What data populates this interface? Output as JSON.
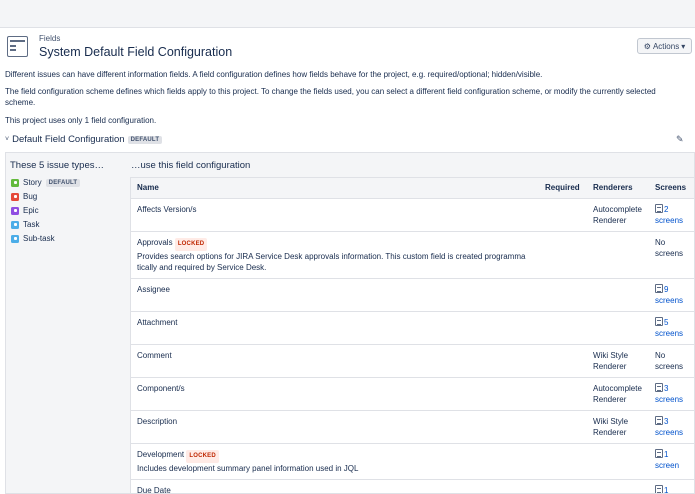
{
  "header": {
    "breadcrumb": "Fields",
    "title": "System Default Field Configuration",
    "actions_label": "Actions",
    "actions_icon": "gear-icon"
  },
  "descriptions": [
    "Different issues can have different information fields. A field configuration defines how fields behave for the project, e.g. required/optional; hidden/visible.",
    "The field configuration scheme defines which fields apply to this project. To change the fields used, you can select a different field configuration scheme, or modify the currently selected scheme.",
    "This project uses only 1 field configuration."
  ],
  "section": {
    "title": "Default Field Configuration",
    "badge": "DEFAULT"
  },
  "issue_types": {
    "heading": "These 5 issue types…",
    "items": [
      {
        "label": "Story",
        "badge": "DEFAULT",
        "color": "#63ba3c"
      },
      {
        "label": "Bug",
        "badge": "",
        "color": "#e5493a"
      },
      {
        "label": "Epic",
        "badge": "",
        "color": "#904ee2"
      },
      {
        "label": "Task",
        "badge": "",
        "color": "#4bade8"
      },
      {
        "label": "Sub-task",
        "badge": "",
        "color": "#4bade8"
      }
    ]
  },
  "config": {
    "heading": "…use this field configuration",
    "columns": {
      "name": "Name",
      "required": "Required",
      "renderers": "Renderers",
      "screens": "Screens"
    },
    "rows": [
      {
        "name": "Affects Version/s",
        "locked": "",
        "description": "",
        "renderer": "Autocomplete Renderer",
        "screens_count": "2",
        "screens_word": "screens",
        "screens_text": ""
      },
      {
        "name": "Approvals",
        "locked": "LOCKED",
        "description": "Provides search options for JIRA Service Desk approvals information. This custom field is created programma tically and required by Service Desk.",
        "renderer": "",
        "screens_count": "",
        "screens_word": "",
        "screens_text": "No screens"
      },
      {
        "name": "Assignee",
        "locked": "",
        "description": "",
        "renderer": "",
        "screens_count": "9",
        "screens_word": "screens",
        "screens_text": ""
      },
      {
        "name": "Attachment",
        "locked": "",
        "description": "",
        "renderer": "",
        "screens_count": "5",
        "screens_word": "screens",
        "screens_text": ""
      },
      {
        "name": "Comment",
        "locked": "",
        "description": "",
        "renderer": "Wiki Style Renderer",
        "screens_count": "",
        "screens_word": "",
        "screens_text": "No screens"
      },
      {
        "name": "Component/s",
        "locked": "",
        "description": "",
        "renderer": "Autocomplete Renderer",
        "screens_count": "3",
        "screens_word": "screens",
        "screens_text": ""
      },
      {
        "name": "Description",
        "locked": "",
        "description": "",
        "renderer": "Wiki Style Renderer",
        "screens_count": "3",
        "screens_word": "screens",
        "screens_text": ""
      },
      {
        "name": "Development",
        "locked": "LOCKED",
        "description": "Includes development summary panel information used in JQL",
        "renderer": "",
        "screens_count": "1",
        "screens_word": "screen",
        "screens_text": ""
      },
      {
        "name": "Due Date",
        "locked": "",
        "description": "",
        "renderer": "",
        "screens_count": "1",
        "screens_word": "",
        "screens_text": ""
      }
    ]
  }
}
